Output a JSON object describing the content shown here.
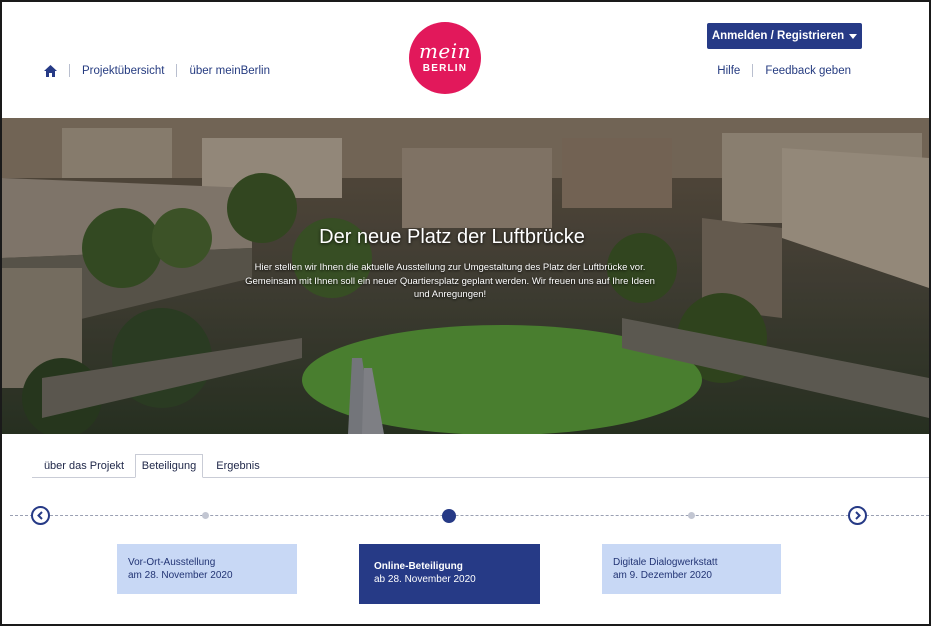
{
  "header": {
    "nav_left": [
      {
        "label": "Projektübersicht"
      },
      {
        "label": "über meinBerlin"
      }
    ],
    "logo": {
      "line1": "mein",
      "line2": "BERLIN",
      "color": "#e2185b"
    },
    "login_button": "Anmelden / Registrieren",
    "nav_right": [
      {
        "label": "Hilfe"
      },
      {
        "label": "Feedback geben"
      }
    ]
  },
  "hero": {
    "title": "Der neue Platz der Luftbrücke",
    "text": "Hier stellen wir Ihnen die aktuelle Ausstellung zur Umgestaltung des Platz der Luftbrücke vor. Gemeinsam mit Ihnen soll ein neuer Quartiersplatz geplant werden. Wir freuen uns auf Ihre Ideen und Anregungen!"
  },
  "tabs": [
    {
      "label": "über das Projekt",
      "active": false
    },
    {
      "label": "Beteiligung",
      "active": true
    },
    {
      "label": "Ergebnis",
      "active": false
    }
  ],
  "timeline": {
    "phases": [
      {
        "title": "Vor-Ort-Ausstellung",
        "date": "am 28. November 2020",
        "state": "inactive"
      },
      {
        "title": "Online-Beteiligung",
        "date": "ab 28. November 2020",
        "state": "active"
      },
      {
        "title": "Digitale Dialogwerkstatt",
        "date": "am 9. Dezember 2020",
        "state": "inactive"
      }
    ]
  },
  "colors": {
    "primary": "#263a86",
    "brand": "#e2185b",
    "phase_light": "#c8d8f5"
  },
  "icons": {
    "home": "home-icon",
    "prev": "chevron-left-icon",
    "next": "chevron-right-icon",
    "caret": "caret-down-icon"
  }
}
